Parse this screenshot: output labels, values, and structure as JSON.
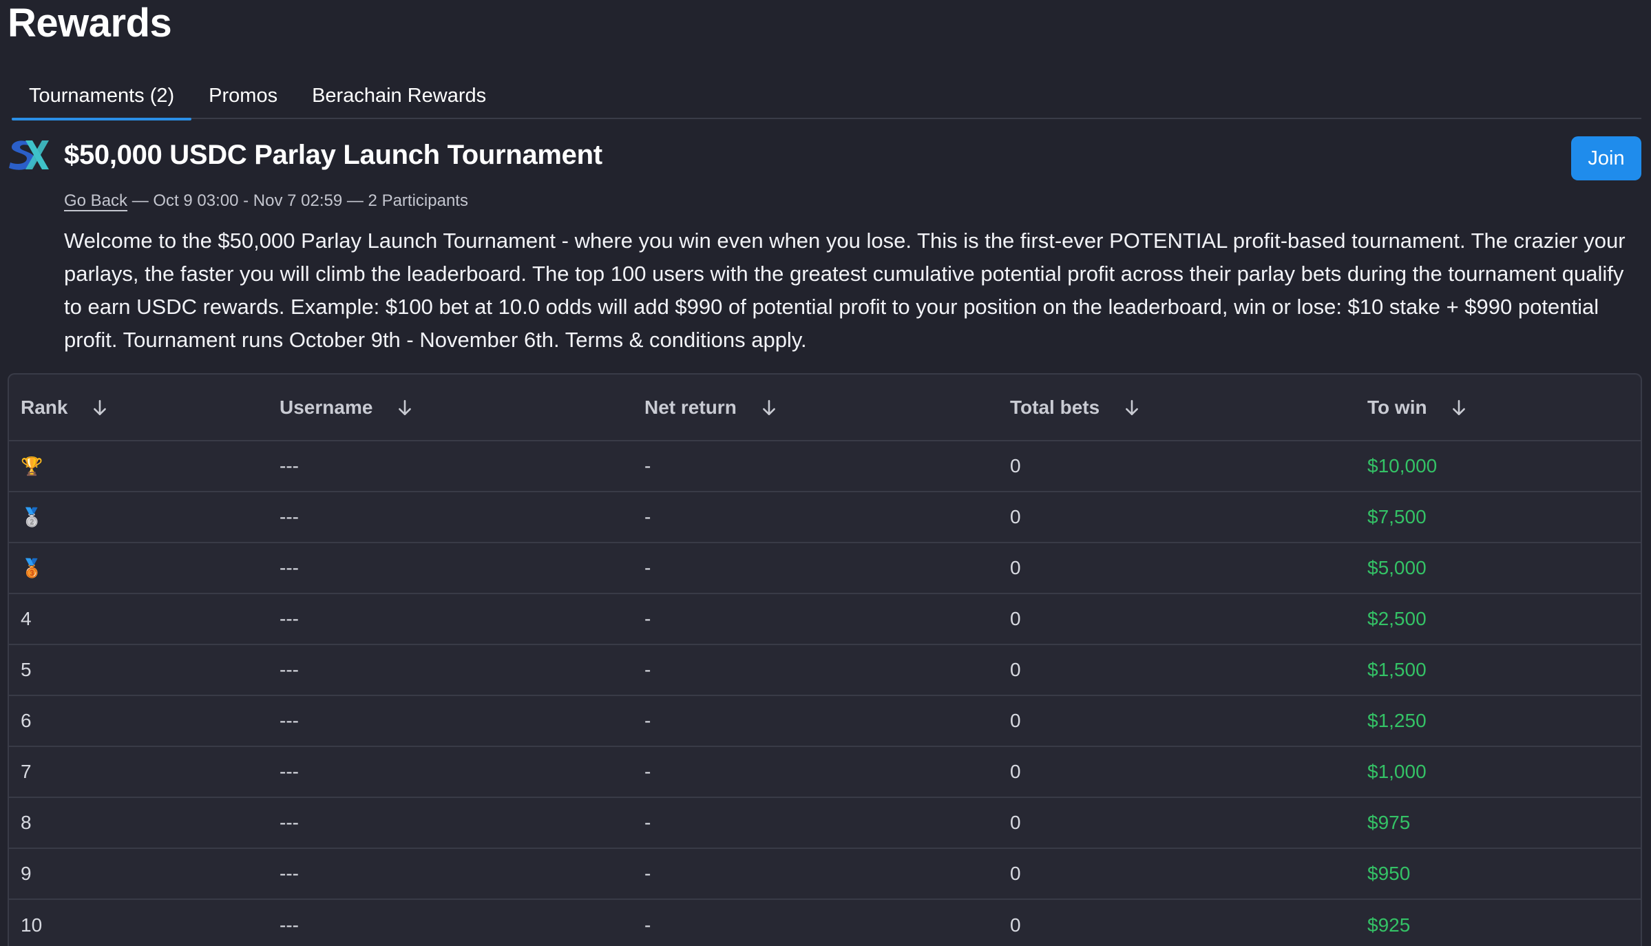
{
  "page": {
    "title": "Rewards"
  },
  "tabs": [
    {
      "label": "Tournaments (2)",
      "active": true
    },
    {
      "label": "Promos",
      "active": false
    },
    {
      "label": "Berachain Rewards",
      "active": false
    }
  ],
  "tournament": {
    "title": "$50,000 USDC Parlay Launch Tournament",
    "join_label": "Join",
    "go_back": "Go Back",
    "meta_text": " — Oct 9 03:00 - Nov 7 02:59 — 2 Participants",
    "description": "Welcome to the $50,000 Parlay Launch Tournament - where you win even when you lose.   This is the first-ever POTENTIAL profit-based tournament. The crazier your parlays, the faster you will climb the leaderboard. The top 100 users with the greatest cumulative potential profit across their parlay bets during the tournament qualify to earn USDC rewards. Example: $100 bet at 10.0 odds will add $990 of potential profit to your position on the leaderboard, win or lose: $10 stake + $990 potential profit. Tournament runs October 9th - November 6th. Terms & conditions apply."
  },
  "table": {
    "columns": [
      "Rank",
      "Username",
      "Net return",
      "Total bets",
      "To win"
    ],
    "rows": [
      {
        "rank": "🏆",
        "username": "---",
        "net_return": "-",
        "total_bets": "0",
        "to_win": "$10,000"
      },
      {
        "rank": "🥈",
        "username": "---",
        "net_return": "-",
        "total_bets": "0",
        "to_win": "$7,500"
      },
      {
        "rank": "🥉",
        "username": "---",
        "net_return": "-",
        "total_bets": "0",
        "to_win": "$5,000"
      },
      {
        "rank": "4",
        "username": "---",
        "net_return": "-",
        "total_bets": "0",
        "to_win": "$2,500"
      },
      {
        "rank": "5",
        "username": "---",
        "net_return": "-",
        "total_bets": "0",
        "to_win": "$1,500"
      },
      {
        "rank": "6",
        "username": "---",
        "net_return": "-",
        "total_bets": "0",
        "to_win": "$1,250"
      },
      {
        "rank": "7",
        "username": "---",
        "net_return": "-",
        "total_bets": "0",
        "to_win": "$1,000"
      },
      {
        "rank": "8",
        "username": "---",
        "net_return": "-",
        "total_bets": "0",
        "to_win": "$975"
      },
      {
        "rank": "9",
        "username": "---",
        "net_return": "-",
        "total_bets": "0",
        "to_win": "$950"
      },
      {
        "rank": "10",
        "username": "---",
        "net_return": "-",
        "total_bets": "0",
        "to_win": "$925"
      }
    ]
  },
  "colors": {
    "background": "#22232d",
    "accent": "#1f8cec",
    "win": "#34c266",
    "logo_blue": "#2b5fc9",
    "logo_teal": "#3fc2c9"
  },
  "icons": {
    "logo": "sx-logo-icon",
    "sort": "arrow-down-icon"
  }
}
